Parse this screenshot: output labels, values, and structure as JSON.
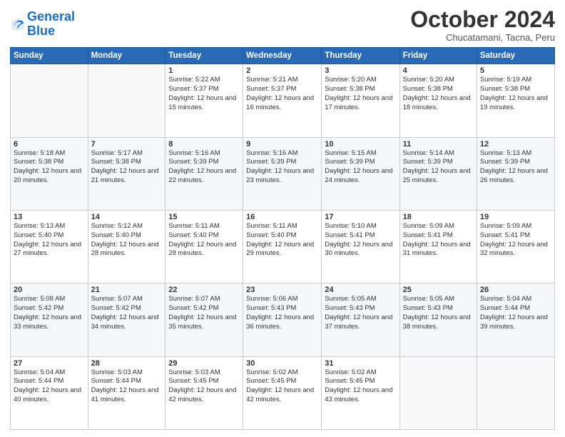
{
  "logo": {
    "line1": "General",
    "line2": "Blue"
  },
  "header": {
    "title": "October 2024",
    "subtitle": "Chucatamani, Tacna, Peru"
  },
  "weekdays": [
    "Sunday",
    "Monday",
    "Tuesday",
    "Wednesday",
    "Thursday",
    "Friday",
    "Saturday"
  ],
  "weeks": [
    [
      {
        "day": "",
        "text": ""
      },
      {
        "day": "",
        "text": ""
      },
      {
        "day": "1",
        "text": "Sunrise: 5:22 AM\nSunset: 5:37 PM\nDaylight: 12 hours and 15 minutes."
      },
      {
        "day": "2",
        "text": "Sunrise: 5:21 AM\nSunset: 5:37 PM\nDaylight: 12 hours and 16 minutes."
      },
      {
        "day": "3",
        "text": "Sunrise: 5:20 AM\nSunset: 5:38 PM\nDaylight: 12 hours and 17 minutes."
      },
      {
        "day": "4",
        "text": "Sunrise: 5:20 AM\nSunset: 5:38 PM\nDaylight: 12 hours and 18 minutes."
      },
      {
        "day": "5",
        "text": "Sunrise: 5:19 AM\nSunset: 5:38 PM\nDaylight: 12 hours and 19 minutes."
      }
    ],
    [
      {
        "day": "6",
        "text": "Sunrise: 5:18 AM\nSunset: 5:38 PM\nDaylight: 12 hours and 20 minutes."
      },
      {
        "day": "7",
        "text": "Sunrise: 5:17 AM\nSunset: 5:38 PM\nDaylight: 12 hours and 21 minutes."
      },
      {
        "day": "8",
        "text": "Sunrise: 5:16 AM\nSunset: 5:39 PM\nDaylight: 12 hours and 22 minutes."
      },
      {
        "day": "9",
        "text": "Sunrise: 5:16 AM\nSunset: 5:39 PM\nDaylight: 12 hours and 23 minutes."
      },
      {
        "day": "10",
        "text": "Sunrise: 5:15 AM\nSunset: 5:39 PM\nDaylight: 12 hours and 24 minutes."
      },
      {
        "day": "11",
        "text": "Sunrise: 5:14 AM\nSunset: 5:39 PM\nDaylight: 12 hours and 25 minutes."
      },
      {
        "day": "12",
        "text": "Sunrise: 5:13 AM\nSunset: 5:39 PM\nDaylight: 12 hours and 26 minutes."
      }
    ],
    [
      {
        "day": "13",
        "text": "Sunrise: 5:13 AM\nSunset: 5:40 PM\nDaylight: 12 hours and 27 minutes."
      },
      {
        "day": "14",
        "text": "Sunrise: 5:12 AM\nSunset: 5:40 PM\nDaylight: 12 hours and 28 minutes."
      },
      {
        "day": "15",
        "text": "Sunrise: 5:11 AM\nSunset: 5:40 PM\nDaylight: 12 hours and 28 minutes."
      },
      {
        "day": "16",
        "text": "Sunrise: 5:11 AM\nSunset: 5:40 PM\nDaylight: 12 hours and 29 minutes."
      },
      {
        "day": "17",
        "text": "Sunrise: 5:10 AM\nSunset: 5:41 PM\nDaylight: 12 hours and 30 minutes."
      },
      {
        "day": "18",
        "text": "Sunrise: 5:09 AM\nSunset: 5:41 PM\nDaylight: 12 hours and 31 minutes."
      },
      {
        "day": "19",
        "text": "Sunrise: 5:09 AM\nSunset: 5:41 PM\nDaylight: 12 hours and 32 minutes."
      }
    ],
    [
      {
        "day": "20",
        "text": "Sunrise: 5:08 AM\nSunset: 5:42 PM\nDaylight: 12 hours and 33 minutes."
      },
      {
        "day": "21",
        "text": "Sunrise: 5:07 AM\nSunset: 5:42 PM\nDaylight: 12 hours and 34 minutes."
      },
      {
        "day": "22",
        "text": "Sunrise: 5:07 AM\nSunset: 5:42 PM\nDaylight: 12 hours and 35 minutes."
      },
      {
        "day": "23",
        "text": "Sunrise: 5:06 AM\nSunset: 5:43 PM\nDaylight: 12 hours and 36 minutes."
      },
      {
        "day": "24",
        "text": "Sunrise: 5:05 AM\nSunset: 5:43 PM\nDaylight: 12 hours and 37 minutes."
      },
      {
        "day": "25",
        "text": "Sunrise: 5:05 AM\nSunset: 5:43 PM\nDaylight: 12 hours and 38 minutes."
      },
      {
        "day": "26",
        "text": "Sunrise: 5:04 AM\nSunset: 5:44 PM\nDaylight: 12 hours and 39 minutes."
      }
    ],
    [
      {
        "day": "27",
        "text": "Sunrise: 5:04 AM\nSunset: 5:44 PM\nDaylight: 12 hours and 40 minutes."
      },
      {
        "day": "28",
        "text": "Sunrise: 5:03 AM\nSunset: 5:44 PM\nDaylight: 12 hours and 41 minutes."
      },
      {
        "day": "29",
        "text": "Sunrise: 5:03 AM\nSunset: 5:45 PM\nDaylight: 12 hours and 42 minutes."
      },
      {
        "day": "30",
        "text": "Sunrise: 5:02 AM\nSunset: 5:45 PM\nDaylight: 12 hours and 42 minutes."
      },
      {
        "day": "31",
        "text": "Sunrise: 5:02 AM\nSunset: 5:45 PM\nDaylight: 12 hours and 43 minutes."
      },
      {
        "day": "",
        "text": ""
      },
      {
        "day": "",
        "text": ""
      }
    ]
  ]
}
